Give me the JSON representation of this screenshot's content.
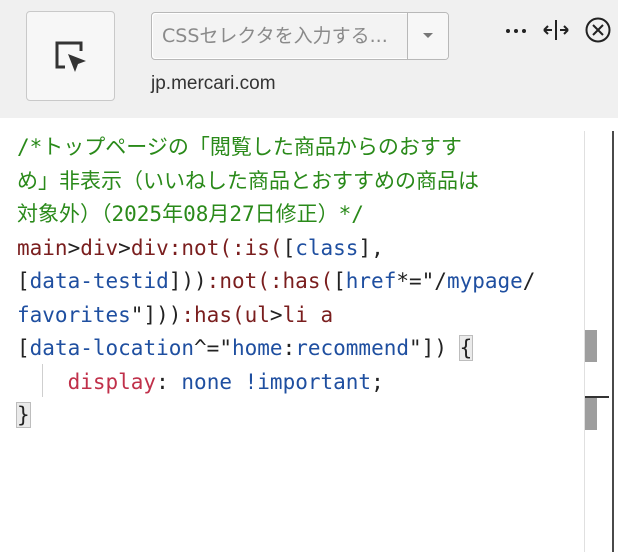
{
  "toolbar": {
    "picker_icon": "element-picker-icon",
    "selector_placeholder": "CSSセレクタを入力する...",
    "selector_value": "",
    "dropdown_icon": "chevron-down-icon",
    "hostname": "jp.mercari.com",
    "more_icon": "more-dots-icon",
    "resize_icon": "resize-horizontal-icon",
    "close_icon": "close-circle-icon"
  },
  "editor": {
    "comment_lines": [
      "/*トップページの「閲覧した商品からのおすす",
      "め」非表示（いいねした商品とおすすめの商品は",
      "対象外）（2025年08月27日修正）*/"
    ],
    "rule": {
      "sel_main": "main",
      "sel_gt1": ">",
      "sel_div1": "div",
      "sel_gt2": ">",
      "sel_div2": "div",
      "sel_not1": ":not(",
      "sel_is": ":is(",
      "br1_open": "[",
      "attr_class": "class",
      "br1_close": "],",
      "br2_open": "[",
      "attr_testid": "data-testid",
      "br2_close": "]))",
      "sel_not2": ":not(",
      "sel_has1": ":has(",
      "br3_open": "[",
      "attr_href": "href",
      "op_contains": "*=",
      "val_href_q1": "\"/",
      "val_href_a": "mypage",
      "val_href_b": "/",
      "val_href_c": "favorites",
      "val_href_q2": "\"",
      "br3_close": "]))",
      "sel_has2": ":has(",
      "sel_ul": "ul",
      "sel_gt3": ">",
      "sel_li": "li",
      "sel_a": " a",
      "br4_open": "[",
      "attr_location": "data-location",
      "op_prefix": "^=",
      "val_loc_q1": "\"",
      "val_loc_a": "home",
      "val_loc_b": ":",
      "val_loc_c": "recommend",
      "val_loc_q2": "\"",
      "br4_close": "])",
      "brace_open": "{",
      "property": "display",
      "colon": ":",
      "value": "none",
      "important": "!important",
      "semicolon": ";",
      "brace_close": "}"
    }
  },
  "colors": {
    "comment": "#2a8a1a",
    "selector": "#7a1e1e",
    "attribute": "#1f4fa0",
    "property": "#c0304a"
  }
}
